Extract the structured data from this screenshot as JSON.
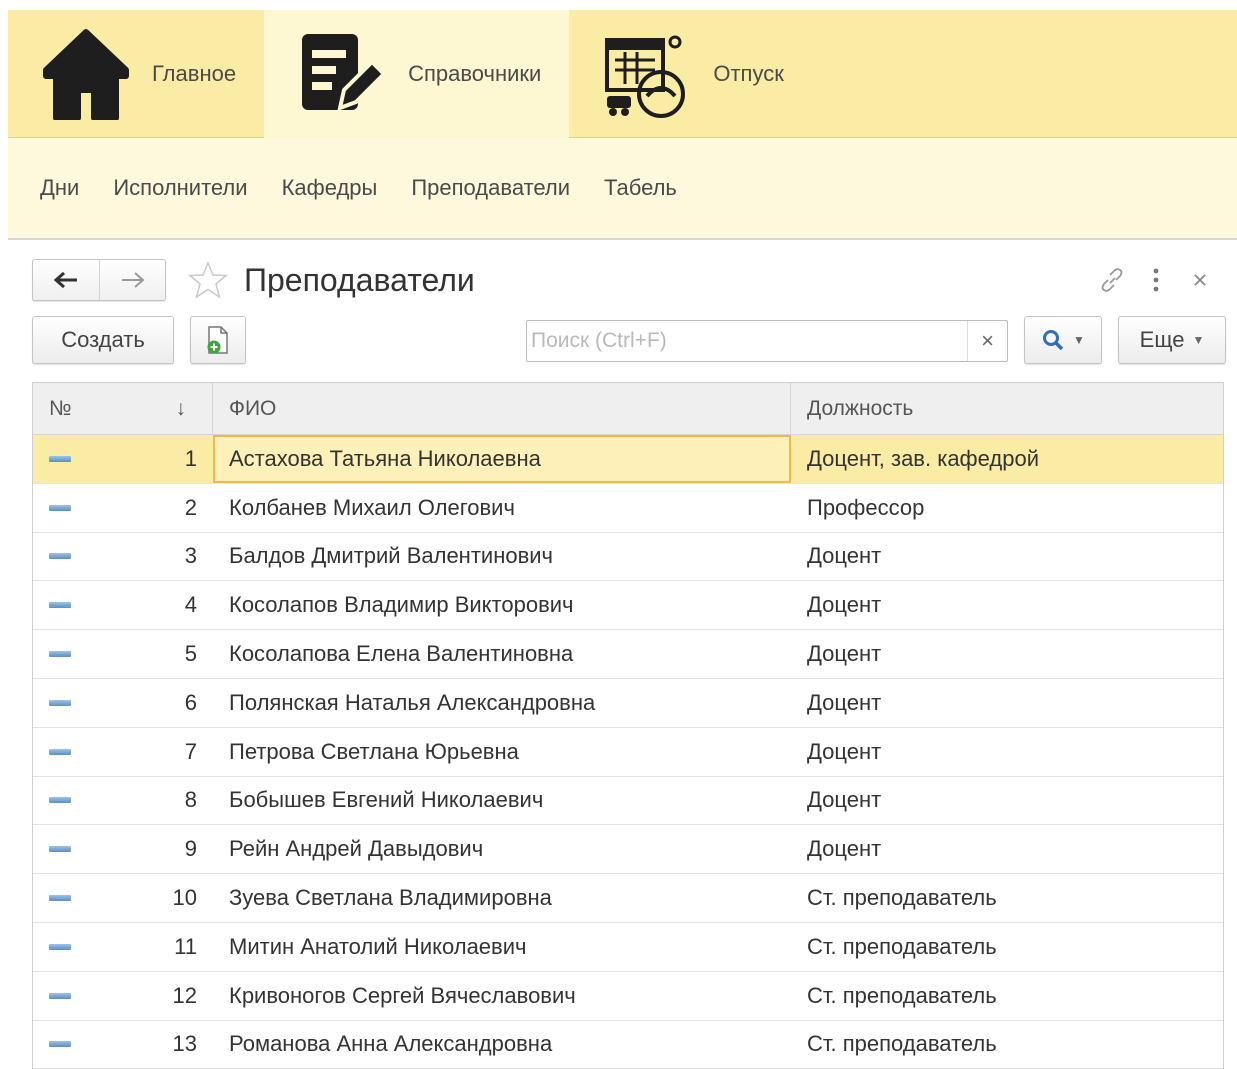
{
  "sections": [
    {
      "label": "Главное",
      "icon": "home-icon"
    },
    {
      "label": "Справочники",
      "icon": "edit-list-icon",
      "active": true
    },
    {
      "label": "Отпуск",
      "icon": "vacation-calendar-icon"
    }
  ],
  "subnav": [
    "Дни",
    "Исполнители",
    "Кафедры",
    "Преподаватели",
    "Табель"
  ],
  "form": {
    "title": "Преподаватели",
    "back_icon": "arrow-left-icon",
    "forward_icon": "arrow-right-icon",
    "favorite_icon": "star-icon",
    "link_icon": "link-icon",
    "menu_icon": "more-vertical-icon",
    "close_icon": "close-icon"
  },
  "toolbar": {
    "create_label": "Создать",
    "add_copy_icon": "add-document-icon",
    "search_placeholder": "Поиск (Ctrl+F)",
    "search_value": "",
    "clear_symbol": "×",
    "find_icon": "magnifier-icon",
    "more_label": "Еще"
  },
  "table": {
    "columns": {
      "num": "№",
      "sort_indicator": "↓",
      "fio": "ФИО",
      "position": "Должность"
    },
    "rows": [
      {
        "n": "1",
        "fio": "Астахова Татьяна Николаевна",
        "position": "Доцент, зав. кафедрой"
      },
      {
        "n": "2",
        "fio": "Колбанев Михаил Олегович",
        "position": "Профессор"
      },
      {
        "n": "3",
        "fio": "Балдов Дмитрий Валентинович",
        "position": "Доцент"
      },
      {
        "n": "4",
        "fio": "Косолапов Владимир Викторович",
        "position": "Доцент"
      },
      {
        "n": "5",
        "fio": "Косолапова Елена Валентиновна",
        "position": "Доцент"
      },
      {
        "n": "6",
        "fio": "Полянская Наталья Александровна",
        "position": "Доцент"
      },
      {
        "n": "7",
        "fio": "Петрова Светлана Юрьевна",
        "position": "Доцент"
      },
      {
        "n": "8",
        "fio": "Бобышев Евгений Николаевич",
        "position": "Доцент"
      },
      {
        "n": "9",
        "fio": "Рейн Андрей Давыдович",
        "position": "Доцент"
      },
      {
        "n": "10",
        "fio": "Зуева Светлана Владимировна",
        "position": "Ст. преподаватель"
      },
      {
        "n": "11",
        "fio": "Митин Анатолий Николаевич",
        "position": "Ст. преподаватель"
      },
      {
        "n": "12",
        "fio": "Кривоногов Сергей Вячеславович",
        "position": "Ст. преподаватель"
      },
      {
        "n": "13",
        "fio": "Романова Анна Александровна",
        "position": "Ст. преподаватель"
      }
    ]
  },
  "colors": {
    "section_bar": "#fbeca5",
    "subnav": "#fef9dc",
    "selected_row": "#fbeca5",
    "row_icon": "#5a8fc4"
  }
}
